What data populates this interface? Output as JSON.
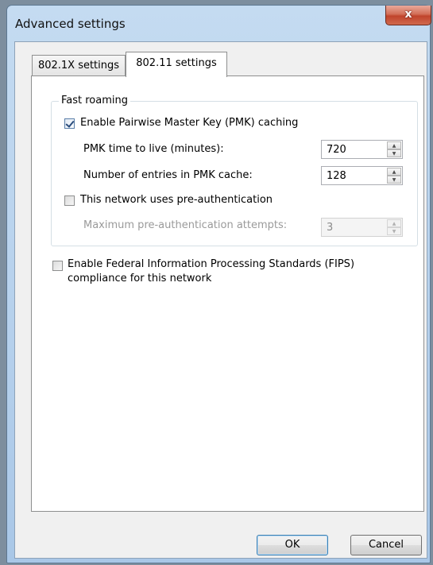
{
  "window": {
    "title": "Advanced settings",
    "close_label": "x"
  },
  "tabs": [
    {
      "label": "802.1X settings",
      "active": false
    },
    {
      "label": "802.11 settings",
      "active": true
    }
  ],
  "fast_roaming": {
    "group_title": "Fast roaming",
    "pmk_caching": {
      "label": "Enable Pairwise Master Key (PMK) caching",
      "checked": true
    },
    "pmk_ttl": {
      "label": "PMK time to live (minutes):",
      "value": "720"
    },
    "pmk_entries": {
      "label": "Number of entries in PMK cache:",
      "value": "128"
    },
    "preauth": {
      "label": "This network uses pre-authentication",
      "checked": false
    },
    "preauth_attempts": {
      "label": "Maximum pre-authentication attempts:",
      "value": "3",
      "disabled": true
    }
  },
  "fips": {
    "label_line1": "Enable Federal Information Processing Standards (FIPS)",
    "label_line2": "compliance for this network",
    "checked": false
  },
  "buttons": {
    "ok": "OK",
    "cancel": "Cancel"
  },
  "icons": {
    "checkbox_checked": "check-icon",
    "spin_up": "arrow-up-icon",
    "spin_down": "arrow-down-icon"
  }
}
